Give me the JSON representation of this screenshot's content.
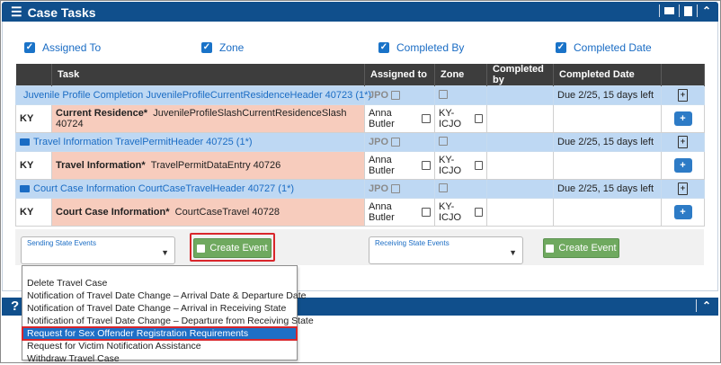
{
  "panel": {
    "title": "Case Tasks",
    "header_icons": [
      "list-icon",
      "envelope-icon",
      "document-icon",
      "chevron-up-icon"
    ]
  },
  "filters": [
    {
      "label": "Assigned To",
      "checked": true
    },
    {
      "label": "Zone",
      "checked": true
    },
    {
      "label": "Completed By",
      "checked": true
    },
    {
      "label": "Completed Date",
      "checked": true
    }
  ],
  "table": {
    "columns": [
      "Task",
      "Assigned to",
      "Zone",
      "Completed by",
      "Completed Date"
    ],
    "groups": [
      {
        "header": "Juvenile Profile Completion JuvenileProfileCurrentResidenceHeader 40723 (1*)",
        "assigned": "JPO",
        "completed_date": "Due 2/25, 15 days left",
        "state": "KY",
        "task_bold": "Current Residence*",
        "task_detail": "JuvenileProfileSlashCurrentResidenceSlash 40724",
        "assigned_name": "Anna Butler",
        "zone": "KY-ICJO"
      },
      {
        "header": "Travel Information TravelPermitHeader 40725 (1*)",
        "assigned": "JPO",
        "completed_date": "Due 2/25, 15 days left",
        "state": "KY",
        "task_bold": "Travel Information*",
        "task_detail": "TravelPermitDataEntry 40726",
        "assigned_name": "Anna Butler",
        "zone": "KY-ICJO"
      },
      {
        "header": "Court Case Information CourtCaseTravelHeader 40727 (1*)",
        "assigned": "JPO",
        "completed_date": "Due 2/25, 15 days left",
        "state": "KY",
        "task_bold": "Court Case Information*",
        "task_detail": "CourtCaseTravel 40728",
        "assigned_name": "Anna Butler",
        "zone": "KY-ICJO"
      }
    ]
  },
  "events": {
    "sending_label": "Sending State Events",
    "receiving_label": "Receiving State Events",
    "create_event": "Create Event"
  },
  "bottom_panel": {
    "icon": "?"
  },
  "dropdown": {
    "items": [
      "Delete Travel Case",
      "Notification of Travel Date Change – Arrival Date & Departure Date",
      "Notification of Travel Date Change – Arrival in Receiving State",
      "Notification of Travel Date Change – Departure from Receiving State",
      "Request for Sex Offender Registration Requirements",
      "Request for Victim Notification Assistance",
      "Withdraw Travel Case"
    ],
    "selected_index": 4
  },
  "colors": {
    "header_bg": "#104f8c",
    "link": "#1a6cc4",
    "group_row": "#bed8f3",
    "task_cell": "#f7ccbd",
    "button_green": "#6fa95f",
    "highlight_red": "#d9262b"
  }
}
